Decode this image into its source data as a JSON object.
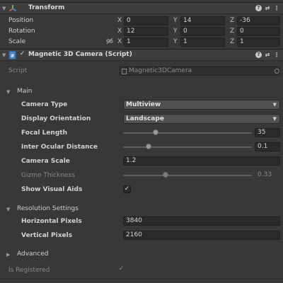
{
  "transform": {
    "title": "Transform",
    "rows": [
      {
        "label": "Position",
        "x": "0",
        "y": "14",
        "z": "-36"
      },
      {
        "label": "Rotation",
        "x": "12",
        "y": "0",
        "z": "0"
      },
      {
        "label": "Scale",
        "x": "1",
        "y": "1",
        "z": "1"
      }
    ],
    "axis": {
      "x": "X",
      "y": "Y",
      "z": "Z"
    }
  },
  "camera": {
    "title": "Magnetic 3D Camera (Script)",
    "script_label": "Script",
    "script_value": "Magnetic3DCamera",
    "main_label": "Main",
    "camera_type_label": "Camera Type",
    "camera_type_value": "Multiview",
    "display_orientation_label": "Display Orientation",
    "display_orientation_value": "Landscape",
    "focal_length_label": "Focal Length",
    "focal_length_value": "35",
    "focal_length_fraction": 0.25,
    "ocular_label": "Inter Ocular Distance",
    "ocular_value": "0.1",
    "ocular_fraction": 0.2,
    "camera_scale_label": "Camera Scale",
    "camera_scale_value": "1.2",
    "gizmo_label": "Gizmo Thickness",
    "gizmo_value": "0.33",
    "gizmo_fraction": 0.33,
    "visual_aids_label": "Show Visual Aids",
    "visual_aids_checked": true,
    "resolution_label": "Resolution Settings",
    "hpixels_label": "Horizontal Pixels",
    "hpixels_value": "3840",
    "vpixels_label": "Vertical Pixels",
    "vpixels_value": "2160",
    "advanced_label": "Advanced",
    "registered_label": "Is Registered",
    "registered_checked": true
  }
}
